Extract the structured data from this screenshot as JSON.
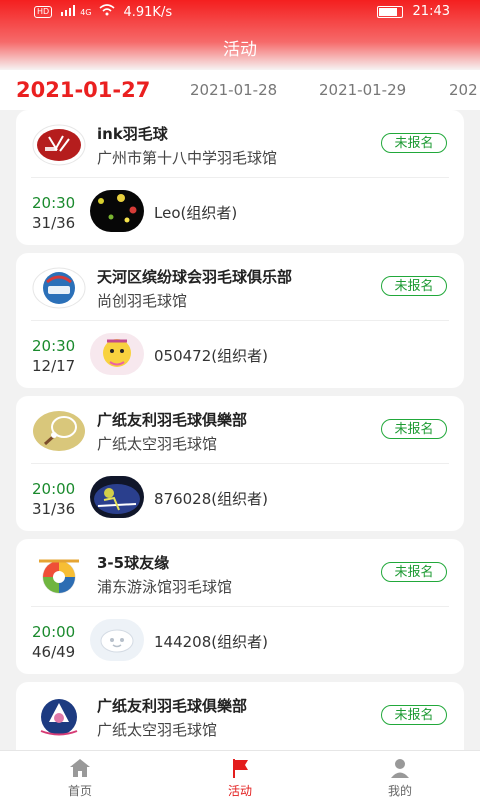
{
  "status_bar": {
    "left_badge": "HD",
    "network": "4G",
    "speed": "4.91K/s",
    "time": "21:43",
    "icons": [
      "hd-icon",
      "signal-icon",
      "wifi-icon",
      "battery-icon"
    ]
  },
  "header": {
    "title": "活动"
  },
  "date_tabs": {
    "items": [
      {
        "label": "2021-01-27",
        "active": true
      },
      {
        "label": "2021-01-28",
        "active": false
      },
      {
        "label": "2021-01-29",
        "active": false
      },
      {
        "label": "202",
        "active": false
      }
    ]
  },
  "events": [
    {
      "club_name": "ink羽毛球",
      "venue": "广州市第十八中学羽毛球馆",
      "signup_label": "未报名",
      "time": "20:30",
      "count": "31/36",
      "organizer": "Leo(组织者)"
    },
    {
      "club_name": "天河区缤纷球会羽毛球俱乐部",
      "venue": "尚创羽毛球馆",
      "signup_label": "未报名",
      "time": "20:30",
      "count": "12/17",
      "organizer": "050472(组织者)"
    },
    {
      "club_name": "广纸友利羽毛球俱樂部",
      "venue": "广纸太空羽毛球馆",
      "signup_label": "未报名",
      "time": "20:00",
      "count": "31/36",
      "organizer": "876028(组织者)"
    },
    {
      "club_name": "3-5球友缘",
      "venue": "浦东游泳馆羽毛球馆",
      "signup_label": "未报名",
      "time": "20:00",
      "count": "46/49",
      "organizer": "144208(组织者)"
    },
    {
      "club_name": "广纸友利羽毛球俱樂部",
      "venue": "广纸太空羽毛球馆",
      "signup_label": "未报名",
      "time": "",
      "count": "",
      "organizer": ""
    }
  ],
  "bottom_nav": {
    "items": [
      {
        "label": "首页",
        "icon": "home-icon",
        "active": false
      },
      {
        "label": "活动",
        "icon": "flag-icon",
        "active": true
      },
      {
        "label": "我的",
        "icon": "user-icon",
        "active": false
      }
    ]
  },
  "colors": {
    "accent": "#e31d1d",
    "green": "#1d9a33"
  }
}
